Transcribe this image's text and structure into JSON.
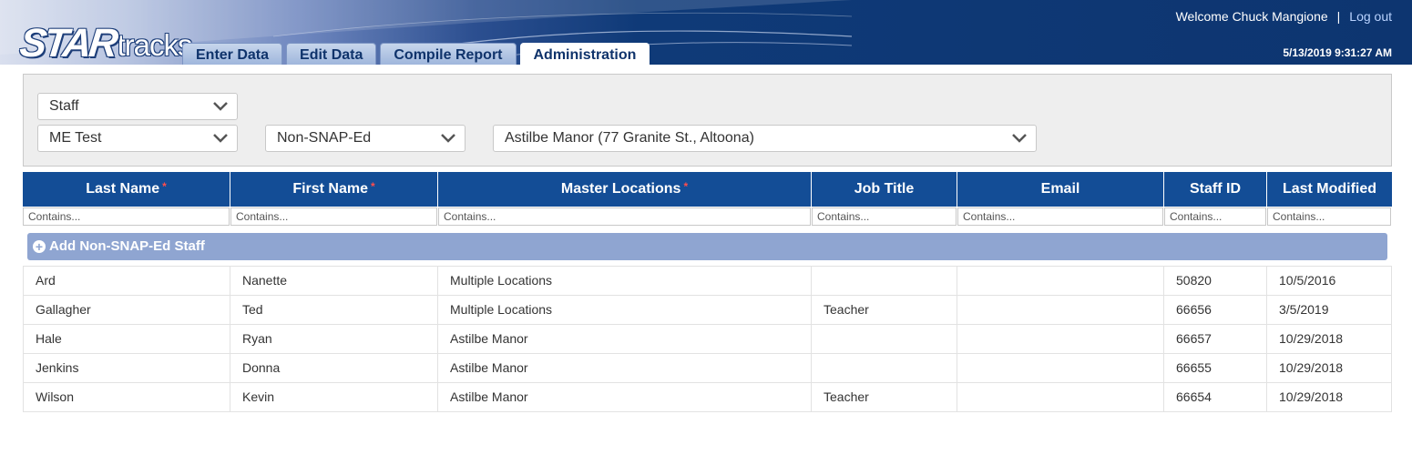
{
  "header": {
    "logo_star": "STAR",
    "logo_tracks": "tracks",
    "welcome_text": "Welcome Chuck Mangione",
    "separator": "|",
    "logout_label": "Log out",
    "datetime": "5/13/2019 9:31:27 AM"
  },
  "tabs": [
    {
      "label": "Enter Data",
      "active": false
    },
    {
      "label": "Edit Data",
      "active": false
    },
    {
      "label": "Compile Report",
      "active": false
    },
    {
      "label": "Administration",
      "active": true
    }
  ],
  "filters": {
    "category": "Staff",
    "program": "ME Test",
    "staff_type": "Non-SNAP-Ed",
    "location": "Astilbe Manor (77 Granite St., Altoona)"
  },
  "table": {
    "columns": [
      {
        "label": "Last Name",
        "required": true
      },
      {
        "label": "First Name",
        "required": true
      },
      {
        "label": "Master Locations",
        "required": true
      },
      {
        "label": "Job Title",
        "required": false
      },
      {
        "label": "Email",
        "required": false
      },
      {
        "label": "Staff ID",
        "required": false
      },
      {
        "label": "Last Modified",
        "required": false
      }
    ],
    "required_marker": "*",
    "filter_placeholder": "Contains...",
    "add_label": "Add Non-SNAP-Ed Staff",
    "rows": [
      [
        "Ard",
        "Nanette",
        "Multiple Locations",
        "",
        "",
        "50820",
        "10/5/2016"
      ],
      [
        "Gallagher",
        "Ted",
        "Multiple Locations",
        "Teacher",
        "",
        "66656",
        "3/5/2019"
      ],
      [
        "Hale",
        "Ryan",
        "Astilbe Manor",
        "",
        "",
        "66657",
        "10/29/2018"
      ],
      [
        "Jenkins",
        "Donna",
        "Astilbe Manor",
        "",
        "",
        "66655",
        "10/29/2018"
      ],
      [
        "Wilson",
        "Kevin",
        "Astilbe Manor",
        "Teacher",
        "",
        "66654",
        "10/29/2018"
      ]
    ]
  },
  "colors": {
    "header_bg": "#0d3570",
    "table_header_bg": "#134d96",
    "add_bar_bg": "#8fa5d1",
    "required_marker": "#ff4d4d",
    "logout_link": "#b9d3ff"
  }
}
